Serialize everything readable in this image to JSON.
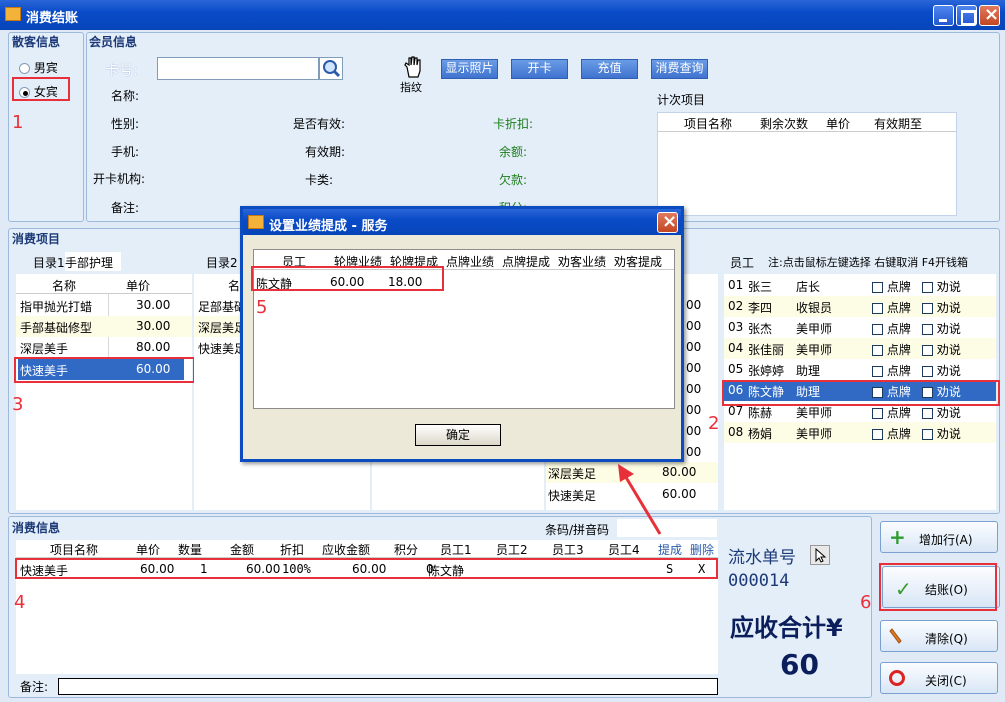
{
  "window": {
    "title": "消费结账"
  },
  "customer": {
    "group_title": "散客信息",
    "male": "男宾",
    "female": "女宾"
  },
  "member": {
    "group_title": "会员信息",
    "card_label": "卡号:",
    "fingerprint_label": "指纹",
    "btn_photo": "显示照片",
    "btn_open_card": "开卡",
    "btn_recharge": "充值",
    "btn_query": "消费查询",
    "name_label": "名称:",
    "gender_label": "性别:",
    "phone_label": "手机:",
    "org_label": "开卡机构:",
    "note_label": "备注:",
    "valid_label": "是否有效:",
    "expiry_label": "有效期:",
    "cardtype_label": "卡类:",
    "discount_label": "卡折扣:",
    "balance_label": "余额:",
    "debt_label": "欠款:",
    "points_label": "积分:",
    "count_title": "计次项目",
    "count_headers": [
      "项目名称",
      "剩余次数",
      "单价",
      "有效期至"
    ]
  },
  "consume_items": {
    "group_title": "消费项目",
    "dir1_label": "目录1",
    "dir1_value": "手部护理",
    "dir2_label": "目录2",
    "headers": [
      "名称",
      "单价"
    ],
    "list1": [
      {
        "name": "指甲抛光打蜡",
        "price": "30.00"
      },
      {
        "name": "手部基础修型",
        "price": "30.00"
      },
      {
        "name": "深层美手",
        "price": "80.00"
      },
      {
        "name": "快速美手",
        "price": "60.00"
      }
    ],
    "list2_header": "名",
    "list2": [
      "足部基础",
      "深层美足",
      "快速美足"
    ],
    "list4": [
      {
        "name": "深层美足",
        "price": "80.00"
      },
      {
        "name": "快速美足",
        "price": "60.00"
      }
    ],
    "list3_partial_prices": [
      "00",
      "00",
      "00",
      "00",
      "00",
      "00",
      "00",
      "00",
      "00",
      "00"
    ]
  },
  "staff": {
    "header_label": "员工",
    "hint": "注:点击鼠标左键选择 右键取消 F4开钱箱",
    "tag1": "点牌",
    "tag2": "劝说",
    "rows": [
      {
        "id": "01",
        "name": "张三",
        "role": "店长"
      },
      {
        "id": "02",
        "name": "李四",
        "role": "收银员"
      },
      {
        "id": "03",
        "name": "张杰",
        "role": "美甲师"
      },
      {
        "id": "04",
        "name": "张佳丽",
        "role": "美甲师"
      },
      {
        "id": "05",
        "name": "张婷婷",
        "role": "助理"
      },
      {
        "id": "06",
        "name": "陈文静",
        "role": "助理"
      },
      {
        "id": "07",
        "name": "陈赫",
        "role": "美甲师"
      },
      {
        "id": "08",
        "name": "杨娟",
        "role": "美甲师"
      }
    ]
  },
  "consume_info": {
    "group_title": "消费信息",
    "barcode_label": "条码/拼音码",
    "headers": [
      "项目名称",
      "单价",
      "数量",
      "金额",
      "折扣",
      "应收金额",
      "积分",
      "员工1",
      "员工2",
      "员工3",
      "员工4",
      "提成",
      "删除"
    ],
    "rows": [
      {
        "item": "快速美手",
        "price": "60.00",
        "qty": "1",
        "amount": "60.00",
        "discount": "100%",
        "receivable": "60.00",
        "points": "0",
        "emp1": "陈文静",
        "emp2": "",
        "emp3": "",
        "emp4": "",
        "commission": "S",
        "delete": "X"
      }
    ],
    "note_label": "备注:"
  },
  "summary": {
    "serial_label": "流水单号",
    "serial_value": "000014",
    "total_label": "应收合计¥",
    "total_value": "60"
  },
  "actions": {
    "add_row": "增加行(A)",
    "checkout": "结账(O)",
    "clear": "清除(Q)",
    "close": "关闭(C)"
  },
  "modal": {
    "title": "设置业绩提成 - 服务",
    "headers": [
      "员工",
      "轮牌业绩",
      "轮牌提成",
      "点牌业绩",
      "点牌提成",
      "劝客业绩",
      "劝客提成"
    ],
    "rows": [
      {
        "employee": "陈文静",
        "rotation_perf": "60.00",
        "rotation_comm": "18.00",
        "point_perf": "",
        "point_comm": "",
        "persuade_perf": "",
        "persuade_comm": ""
      }
    ],
    "ok": "确定"
  },
  "annotations": [
    "1",
    "2",
    "3",
    "4",
    "5",
    "6"
  ],
  "colors": {
    "titlebar": "#0a4bc8",
    "selection": "#316ac5",
    "annotation": "#e8303a",
    "accent_text": "#1c3a78"
  }
}
